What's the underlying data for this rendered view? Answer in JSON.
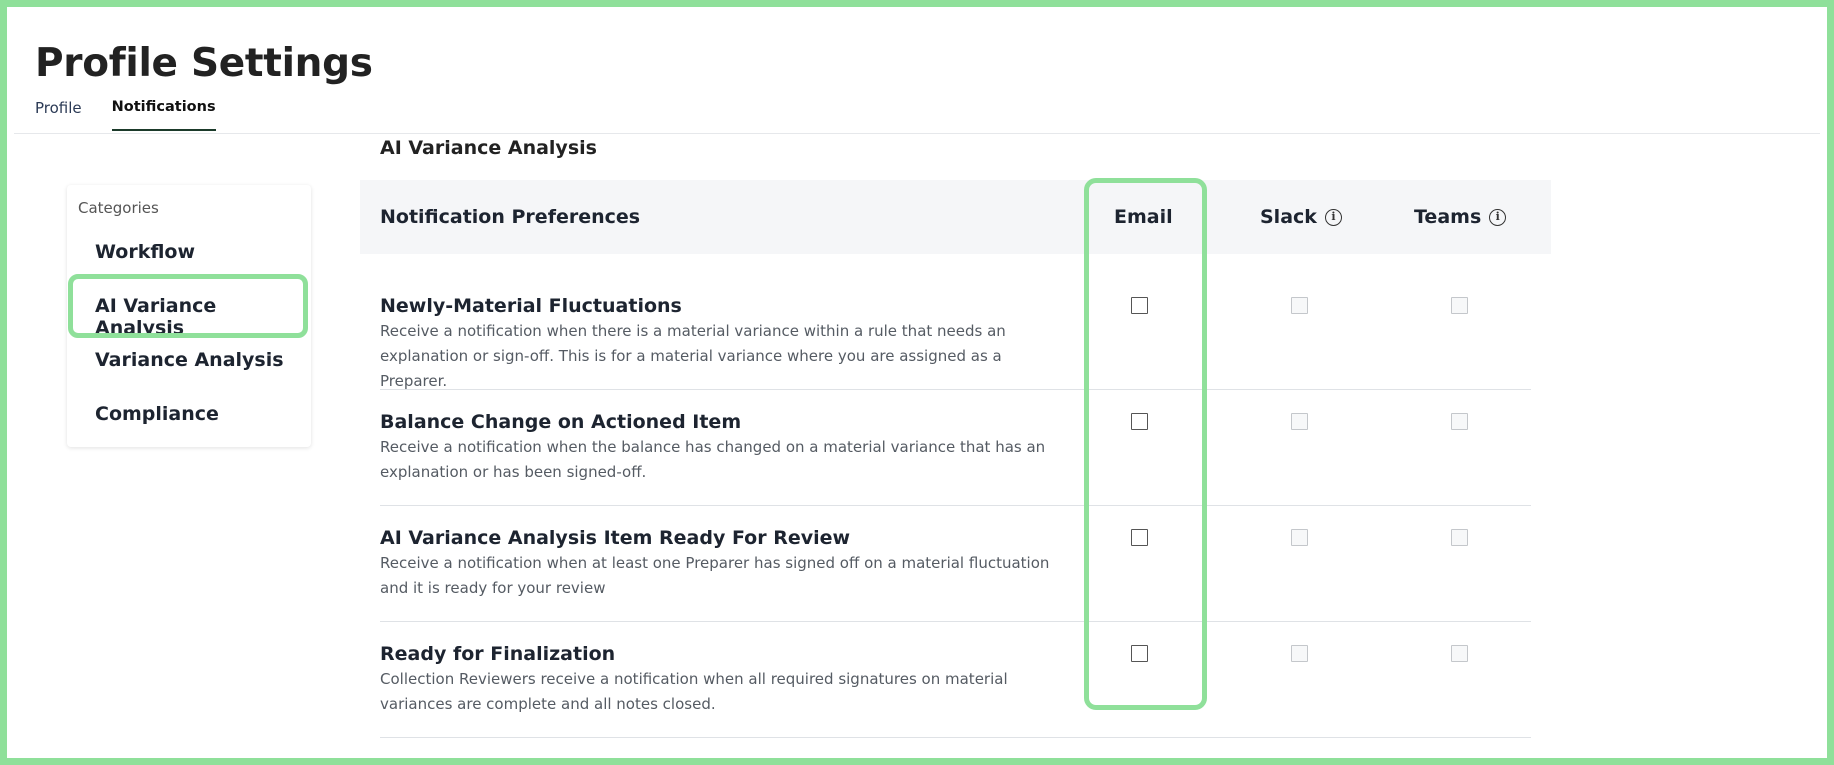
{
  "header": {
    "title": "Profile Settings",
    "tabs": [
      {
        "label": "Profile",
        "active": false
      },
      {
        "label": "Notifications",
        "active": true
      }
    ]
  },
  "section": {
    "title": "AI Variance Analysis"
  },
  "sidebar": {
    "caption": "Categories",
    "items": [
      {
        "label": "Workflow",
        "selected": false
      },
      {
        "label": "AI Variance Analysis",
        "selected": true
      },
      {
        "label": "Variance Analysis",
        "selected": false
      },
      {
        "label": "Compliance",
        "selected": false
      }
    ]
  },
  "table": {
    "columns": {
      "preferences": "Notification Preferences",
      "email": "Email",
      "slack": "Slack",
      "teams": "Teams"
    },
    "rows": [
      {
        "title": "Newly-Material Fluctuations",
        "description": "Receive a notification when there is a material variance within a rule that needs an explanation or sign-off. This is for a material variance where you are assigned as a Preparer.",
        "email": false,
        "slack": false,
        "teams": false
      },
      {
        "title": "Balance Change on Actioned Item",
        "description": "Receive a notification when the balance has changed on a material variance that has an explanation or has been signed-off.",
        "email": false,
        "slack": false,
        "teams": false
      },
      {
        "title": "AI Variance Analysis Item Ready For Review",
        "description": "Receive a notification when at least one Preparer has signed off on a material fluctuation and it is ready for your review",
        "email": false,
        "slack": false,
        "teams": false
      },
      {
        "title": "Ready for Finalization",
        "description": "Collection Reviewers receive a notification when all required signatures on material variances are complete and all notes closed.",
        "email": false,
        "slack": false,
        "teams": false
      }
    ]
  },
  "colors": {
    "highlight": "#8fe09a",
    "active_tab_underline": "#1b3a2a",
    "header_bg": "#f5f6f8"
  },
  "icons": {
    "info": "info-circle-icon",
    "info_glyph": "i"
  }
}
